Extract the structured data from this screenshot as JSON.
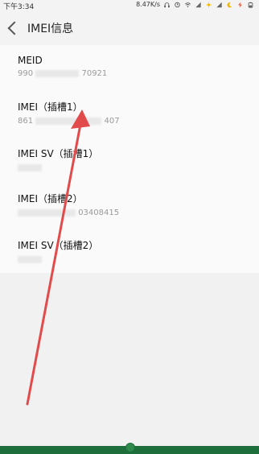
{
  "status": {
    "time": "下午3:34",
    "speed": "8.47K/s"
  },
  "header": {
    "title": "IMEI信息"
  },
  "items": [
    {
      "label": "MEID",
      "value_prefix": "990",
      "value_suffix": "70921"
    },
    {
      "label": "IMEI（插槽1）",
      "value_prefix": "861",
      "value_suffix": "407"
    },
    {
      "label": "IMEI SV（插槽1）",
      "value_prefix": "",
      "value_suffix": ""
    },
    {
      "label": "IMEI（插槽2）",
      "value_prefix": "",
      "value_suffix": "03408415"
    },
    {
      "label": "IMEI SV（插槽2）",
      "value_prefix": "",
      "value_suffix": ""
    }
  ],
  "colors": {
    "annotation_arrow": "#e24b4b",
    "bottom_bar": "#1e6e3b"
  }
}
